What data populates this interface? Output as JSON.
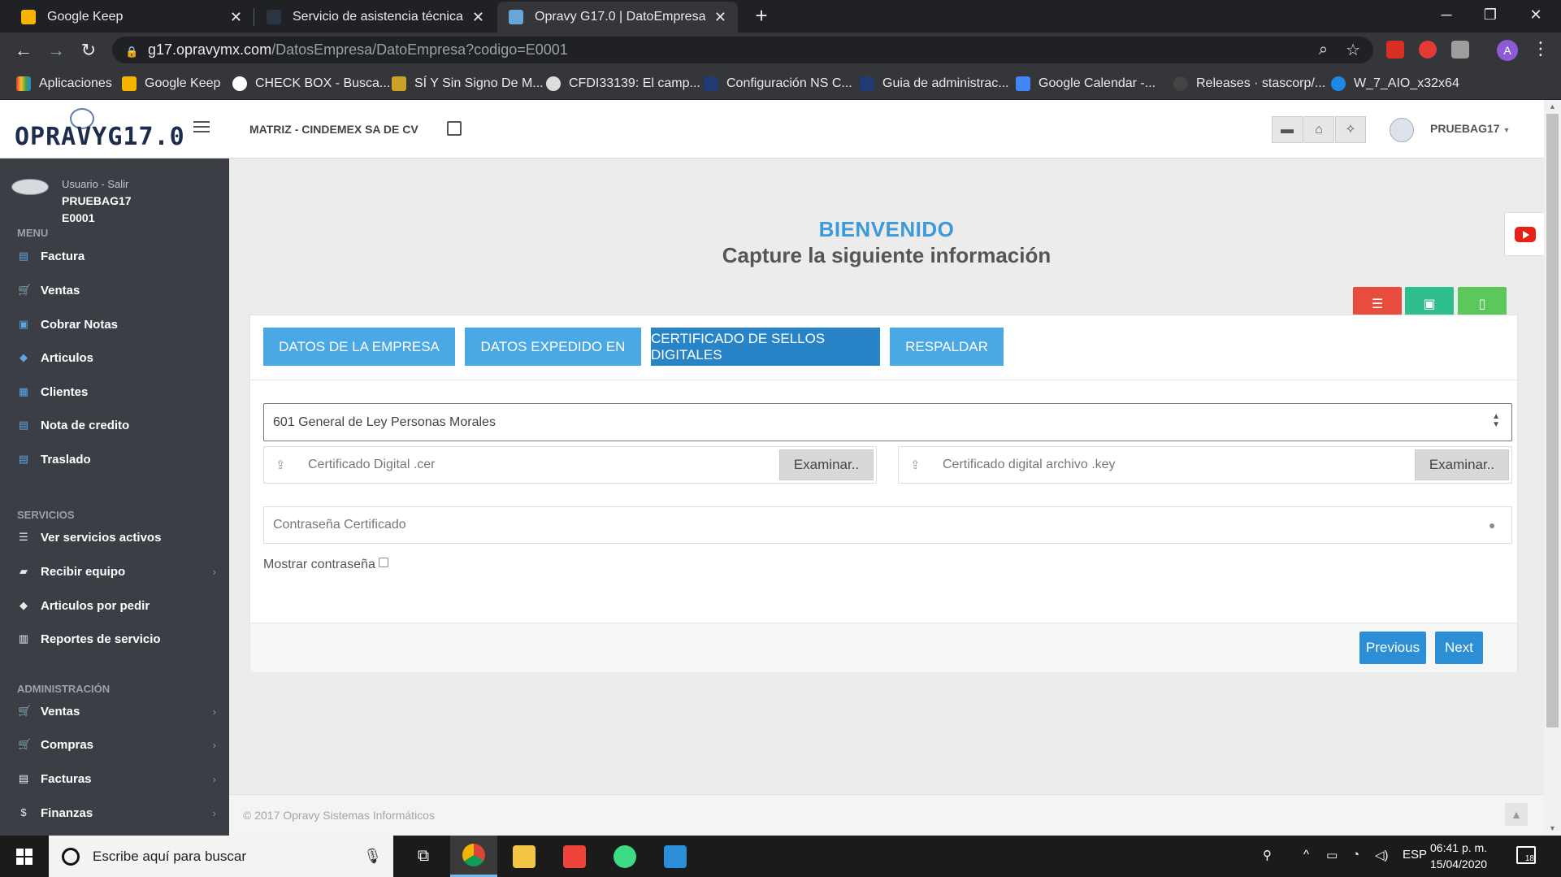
{
  "browser": {
    "tabs": [
      {
        "title": "Google Keep",
        "active": false
      },
      {
        "title": "Servicio de asistencia técnica : Op",
        "active": false
      },
      {
        "title": "Opravy G17.0 | DatoEmpresa",
        "active": true
      }
    ],
    "url_host": "g17.opravymx.com",
    "url_path": "/DatosEmpresa/DatoEmpresa?codigo=E0001",
    "profile_initial": "A",
    "bookmarks": [
      "Aplicaciones",
      "Google Keep",
      "CHECK BOX - Busca...",
      "SÍ Y Sin Signo De M...",
      "CFDI33139: El camp...",
      "Configuración NS C...",
      "Guia de administrac...",
      "Google Calendar -...",
      "Releases · stascorp/...",
      "W_7_AIO_x32x64"
    ]
  },
  "header": {
    "logo_text": "OPRAVYG17.0",
    "company": "MATRIZ - CINDEMEX SA DE CV",
    "username": "PRUEBAG17"
  },
  "sidebar": {
    "user_label": "Usuario - Salir",
    "user_name": "PRUEBAG17",
    "user_code": "E0001",
    "menu_title": "MENU",
    "menu": [
      {
        "label": "Factura",
        "icon": "file-icon"
      },
      {
        "label": "Ventas",
        "icon": "cart-icon"
      },
      {
        "label": "Cobrar Notas",
        "icon": "money-icon"
      },
      {
        "label": "Articulos",
        "icon": "tag-icon"
      },
      {
        "label": "Clientes",
        "icon": "book-icon"
      },
      {
        "label": "Nota de credito",
        "icon": "file-icon"
      },
      {
        "label": "Traslado",
        "icon": "file-icon"
      }
    ],
    "services_title": "SERVICIOS",
    "services": [
      {
        "label": "Ver servicios activos",
        "icon": "list-icon",
        "arrow": false
      },
      {
        "label": "Recibir equipo",
        "icon": "truck-icon",
        "arrow": true
      },
      {
        "label": "Articulos por pedir",
        "icon": "tags-icon",
        "arrow": false
      },
      {
        "label": "Reportes de servicio",
        "icon": "bar-chart-icon",
        "arrow": false
      }
    ],
    "admin_title": "ADMINISTRACIÓN",
    "admin": [
      {
        "label": "Ventas",
        "icon": "cart-icon",
        "arrow": true
      },
      {
        "label": "Compras",
        "icon": "cart-icon",
        "arrow": true
      },
      {
        "label": "Facturas",
        "icon": "file-icon",
        "arrow": true
      },
      {
        "label": "Finanzas",
        "icon": "dollar-icon",
        "arrow": true
      }
    ]
  },
  "main": {
    "welcome": "BIENVENIDO",
    "subtitle": "Capture la siguiente información",
    "wizard_tabs": [
      {
        "label": "DATOS DE LA EMPRESA",
        "current": false
      },
      {
        "label": "DATOS EXPEDIDO EN",
        "current": false
      },
      {
        "label": "CERTIFICADO DE SELLOS DIGITALES",
        "current": true
      },
      {
        "label": "RESPALDAR",
        "current": false
      }
    ],
    "regimen_value": "601 General de Ley Personas Morales",
    "cer_placeholder": "Certificado Digital .cer",
    "key_placeholder": "Certificado digital archivo .key",
    "browse_label": "Examinar..",
    "password_placeholder": "Contraseña Certificado",
    "show_password_label": "Mostrar contraseña",
    "previous_label": "Previous",
    "next_label": "Next",
    "footer": "© 2017 Opravy Sistemas Informáticos"
  },
  "colors": {
    "accent": "#3c99dc",
    "danger": "#e74c3c",
    "success": "#2ebd8f",
    "success_light": "#5cc85c",
    "sidebar": "#3b3f45"
  },
  "taskbar": {
    "search_placeholder": "Escribe aquí para buscar",
    "lang": "ESP",
    "time": "06:41 p. m.",
    "date": "15/04/2020",
    "notifications": "18"
  }
}
